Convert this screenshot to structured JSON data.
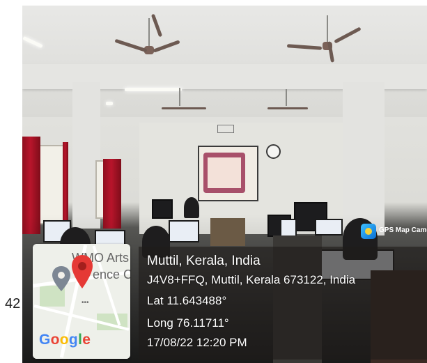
{
  "overlay": {
    "place_title": "Muttil, Kerala, India",
    "address": "J4V8+FFQ, Muttil, Kerala 673122, India",
    "latitude": "Lat 11.643488°",
    "longitude": "Long 76.11711°",
    "datetime": "17/08/22 12:20 PM"
  },
  "map": {
    "label_line1": "WMO Arts",
    "label_line2": "ence Co",
    "dots": "•••",
    "google_letters": [
      "G",
      "o",
      "o",
      "g",
      "l",
      "e"
    ],
    "google_colors": [
      "#4285f4",
      "#ea4335",
      "#fbbc05",
      "#4285f4",
      "#34a853",
      "#ea4335"
    ],
    "pin_color": "#e53935",
    "grey_pin_color": "#7d8794"
  },
  "camera_badge": {
    "text": "GPS Map Camera",
    "icon": "gps-map-camera-icon"
  },
  "edge_text": "42"
}
